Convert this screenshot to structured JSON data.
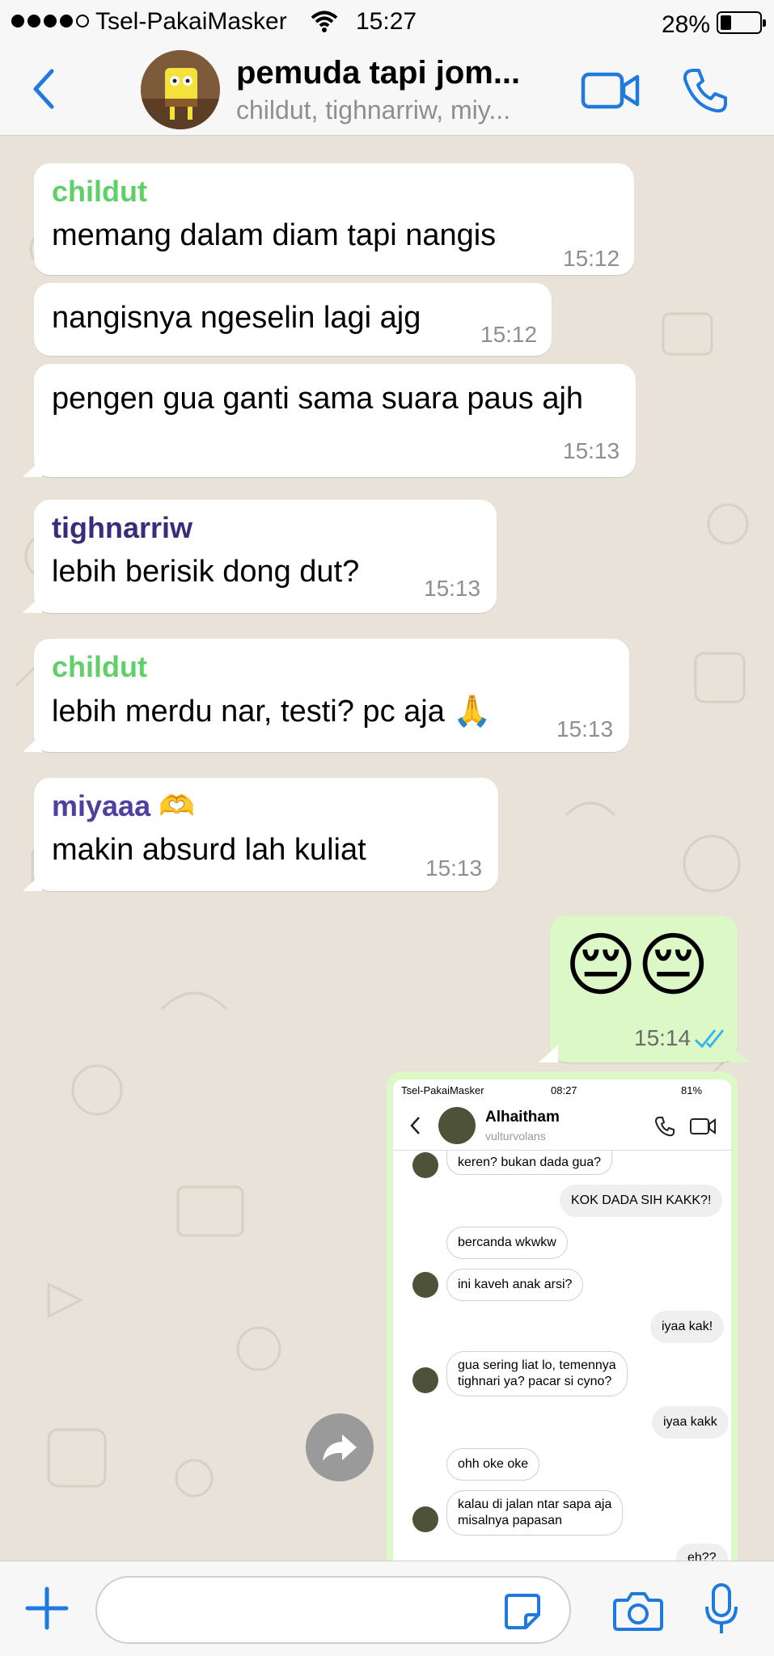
{
  "status": {
    "carrier": "Tsel-PakaiMasker",
    "time": "15:27",
    "battery": "28%",
    "battery_level": 0.28
  },
  "header": {
    "title": "pemuda tapi jom...",
    "subtitle": "childut, tighnarriw, miy..."
  },
  "colors": {
    "accent": "#1f7ae0",
    "outgoing": "#dcf8c6",
    "incoming": "#ffffff",
    "childut": "#5fd068",
    "tighnarriw": "#3c2a7c",
    "miyaaa": "#4f3fa0",
    "read_ticks": "#34b7f1"
  },
  "messages": [
    {
      "sender": "childut",
      "text": "memang dalam diam tapi nangis",
      "time": "15:12"
    },
    {
      "text": "nangisnya ngeselin lagi ajg",
      "time": "15:12"
    },
    {
      "text": "pengen gua ganti sama suara paus ajh",
      "time": "15:13"
    },
    {
      "sender": "tighnarriw",
      "text": "lebih berisik dong dut?",
      "time": "15:13"
    },
    {
      "sender": "childut",
      "text": "lebih merdu nar, testi? pc aja 🙏",
      "time": "15:13"
    },
    {
      "sender": "miyaaa 🫶",
      "text": "makin absurd lah kuliat",
      "time": "15:13"
    },
    {
      "outgoing": true,
      "text": "😔😔",
      "time": "15:14",
      "status_icon": "double-check-read-icon"
    }
  ],
  "shared_screenshot": {
    "status": {
      "carrier": "Tsel-PakaiMasker",
      "time": "08:27",
      "battery": "81%"
    },
    "contact": {
      "name": "Alhaitham",
      "username": "vulturvolans"
    },
    "messages": [
      {
        "side": "in",
        "text": "keren? bukan dada gua?"
      },
      {
        "side": "out",
        "text": "KOK DADA SIH KAKK?!"
      },
      {
        "side": "in",
        "text": "bercanda wkwkw"
      },
      {
        "side": "in",
        "text": "ini kaveh anak arsi?"
      },
      {
        "side": "out",
        "text": "iyaa kak!"
      },
      {
        "side": "in",
        "text": "gua sering liat lo, temennya",
        "text2": "tighnari ya? pacar si cyno?"
      },
      {
        "side": "out",
        "text": "iyaa kakk"
      },
      {
        "side": "in",
        "text": "ohh oke oke"
      },
      {
        "side": "in",
        "text": "kalau di jalan ntar sapa aja",
        "text2": "misalnya papasan"
      },
      {
        "side": "out",
        "text": "eh??"
      }
    ]
  },
  "input": {
    "placeholder": ""
  }
}
